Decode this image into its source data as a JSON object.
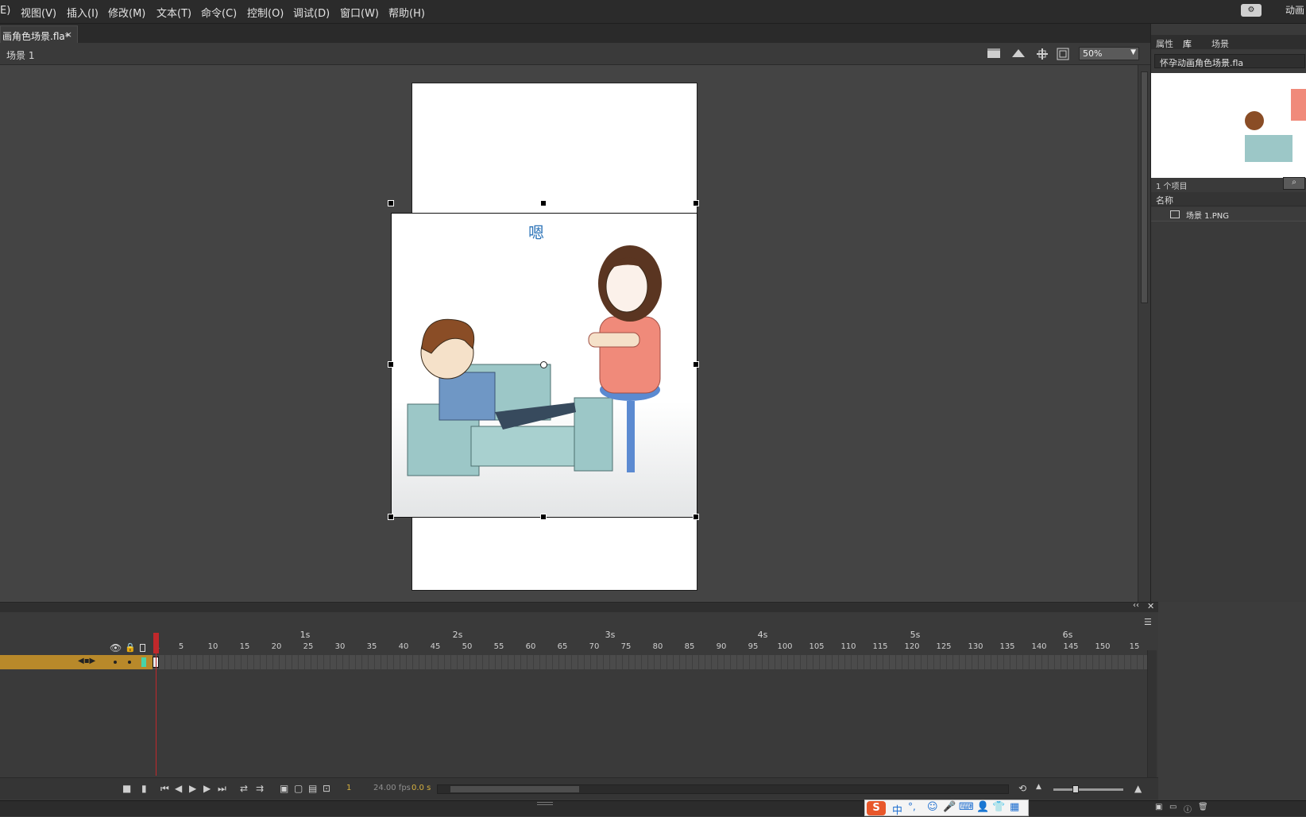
{
  "menu": [
    "E)",
    "视图(V)",
    "插入(I)",
    "修改(M)",
    "文本(T)",
    "命令(C)",
    "控制(O)",
    "调试(D)",
    "窗口(W)",
    "帮助(H)"
  ],
  "workspace_label": "动画",
  "document_tab": {
    "title": "画角色场景.fla*",
    "close": "×"
  },
  "edit_bar": {
    "scene_label": "场景 1",
    "zoom": "50%"
  },
  "stage": {
    "caption": "嗯"
  },
  "right_panel": {
    "tabs": [
      "属性",
      "库",
      "场景"
    ],
    "library_file": "怀孕动画角色场景.fla",
    "item_count": "1 个项目",
    "column_header": "名称",
    "items": [
      "场景 1.PNG"
    ]
  },
  "timeline": {
    "seconds": [
      "1s",
      "2s",
      "3s",
      "4s",
      "5s",
      "6s"
    ],
    "frame_ticks": [
      "1",
      "5",
      "10",
      "15",
      "20",
      "25",
      "30",
      "35",
      "40",
      "45",
      "50",
      "55",
      "60",
      "65",
      "70",
      "75",
      "80",
      "85",
      "90",
      "95",
      "100",
      "105",
      "110",
      "115",
      "120",
      "125",
      "130",
      "135",
      "140",
      "145",
      "150",
      "15"
    ],
    "current_frame": "1",
    "fps": "24.00 fps",
    "elapsed": "0.0 s"
  },
  "ime": {
    "labels": [
      "中",
      "°,"
    ]
  },
  "colors": {
    "layer_active": "#b8892a",
    "playhead": "#c0282b",
    "accent": "#4fa3e0",
    "keyframe": "#46d3a8"
  }
}
